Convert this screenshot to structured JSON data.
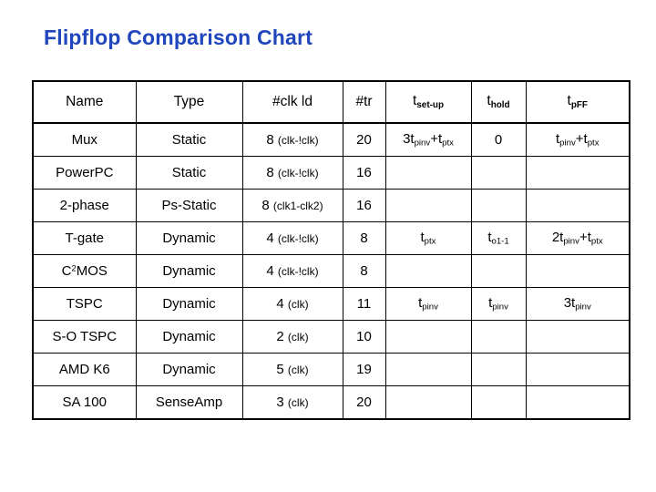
{
  "slide": {
    "title": "Flipflop Comparison Chart",
    "title_color": "#1f46bd",
    "background": "#ffffff"
  },
  "table": {
    "headers": {
      "name": "Name",
      "type": "Type",
      "clk_ld": "#clk ld",
      "tr": "#tr",
      "t_setup_base": "t",
      "t_setup_sub": "set-up",
      "t_hold_base": "t",
      "t_hold_sub": "hold",
      "t_pff_base": "t",
      "t_pff_sub": "pFF"
    },
    "rows": [
      {
        "name": "Mux",
        "type": "Static",
        "clk_num": "8",
        "clk_paren": "(clk-!clk)",
        "tr": "20",
        "t_setup": "3t_pinv+t_ptx",
        "t_hold": "0",
        "t_pff": "t_pinv+t_ptx"
      },
      {
        "name": "PowerPC",
        "type": "Static",
        "clk_num": "8",
        "clk_paren": "(clk-!clk)",
        "tr": "16",
        "t_setup": "",
        "t_hold": "",
        "t_pff": ""
      },
      {
        "name": "2-phase",
        "type": "Ps-Static",
        "clk_num": "8",
        "clk_paren": "(clk1-clk2)",
        "tr": "16",
        "t_setup": "",
        "t_hold": "",
        "t_pff": ""
      },
      {
        "name": "T-gate",
        "type": "Dynamic",
        "clk_num": "4",
        "clk_paren": "(clk-!clk)",
        "tr": "8",
        "t_setup": "t_ptx",
        "t_hold": "t_o1-1",
        "t_pff": "2t_pinv+t_ptx"
      },
      {
        "name": "C2MOS",
        "name_base": "C",
        "name_sup": "2",
        "name_tail": "MOS",
        "type": "Dynamic",
        "clk_num": "4",
        "clk_paren": "(clk-!clk)",
        "tr": "8",
        "t_setup": "",
        "t_hold": "",
        "t_pff": ""
      },
      {
        "name": "TSPC",
        "type": "Dynamic",
        "clk_num": "4",
        "clk_paren": "(clk)",
        "tr": "11",
        "t_setup": "t_pinv",
        "t_hold": "t_pinv",
        "t_pff": "3t_pinv"
      },
      {
        "name": "S-O TSPC",
        "type": "Dynamic",
        "clk_num": "2",
        "clk_paren": "(clk)",
        "tr": "10",
        "t_setup": "",
        "t_hold": "",
        "t_pff": ""
      },
      {
        "name": "AMD K6",
        "type": "Dynamic",
        "clk_num": "5",
        "clk_paren": "(clk)",
        "tr": "19",
        "t_setup": "",
        "t_hold": "",
        "t_pff": ""
      },
      {
        "name": "SA 100",
        "type": "SenseAmp",
        "clk_num": "3",
        "clk_paren": "(clk)",
        "tr": "20",
        "t_setup": "",
        "t_hold": "",
        "t_pff": ""
      }
    ]
  }
}
